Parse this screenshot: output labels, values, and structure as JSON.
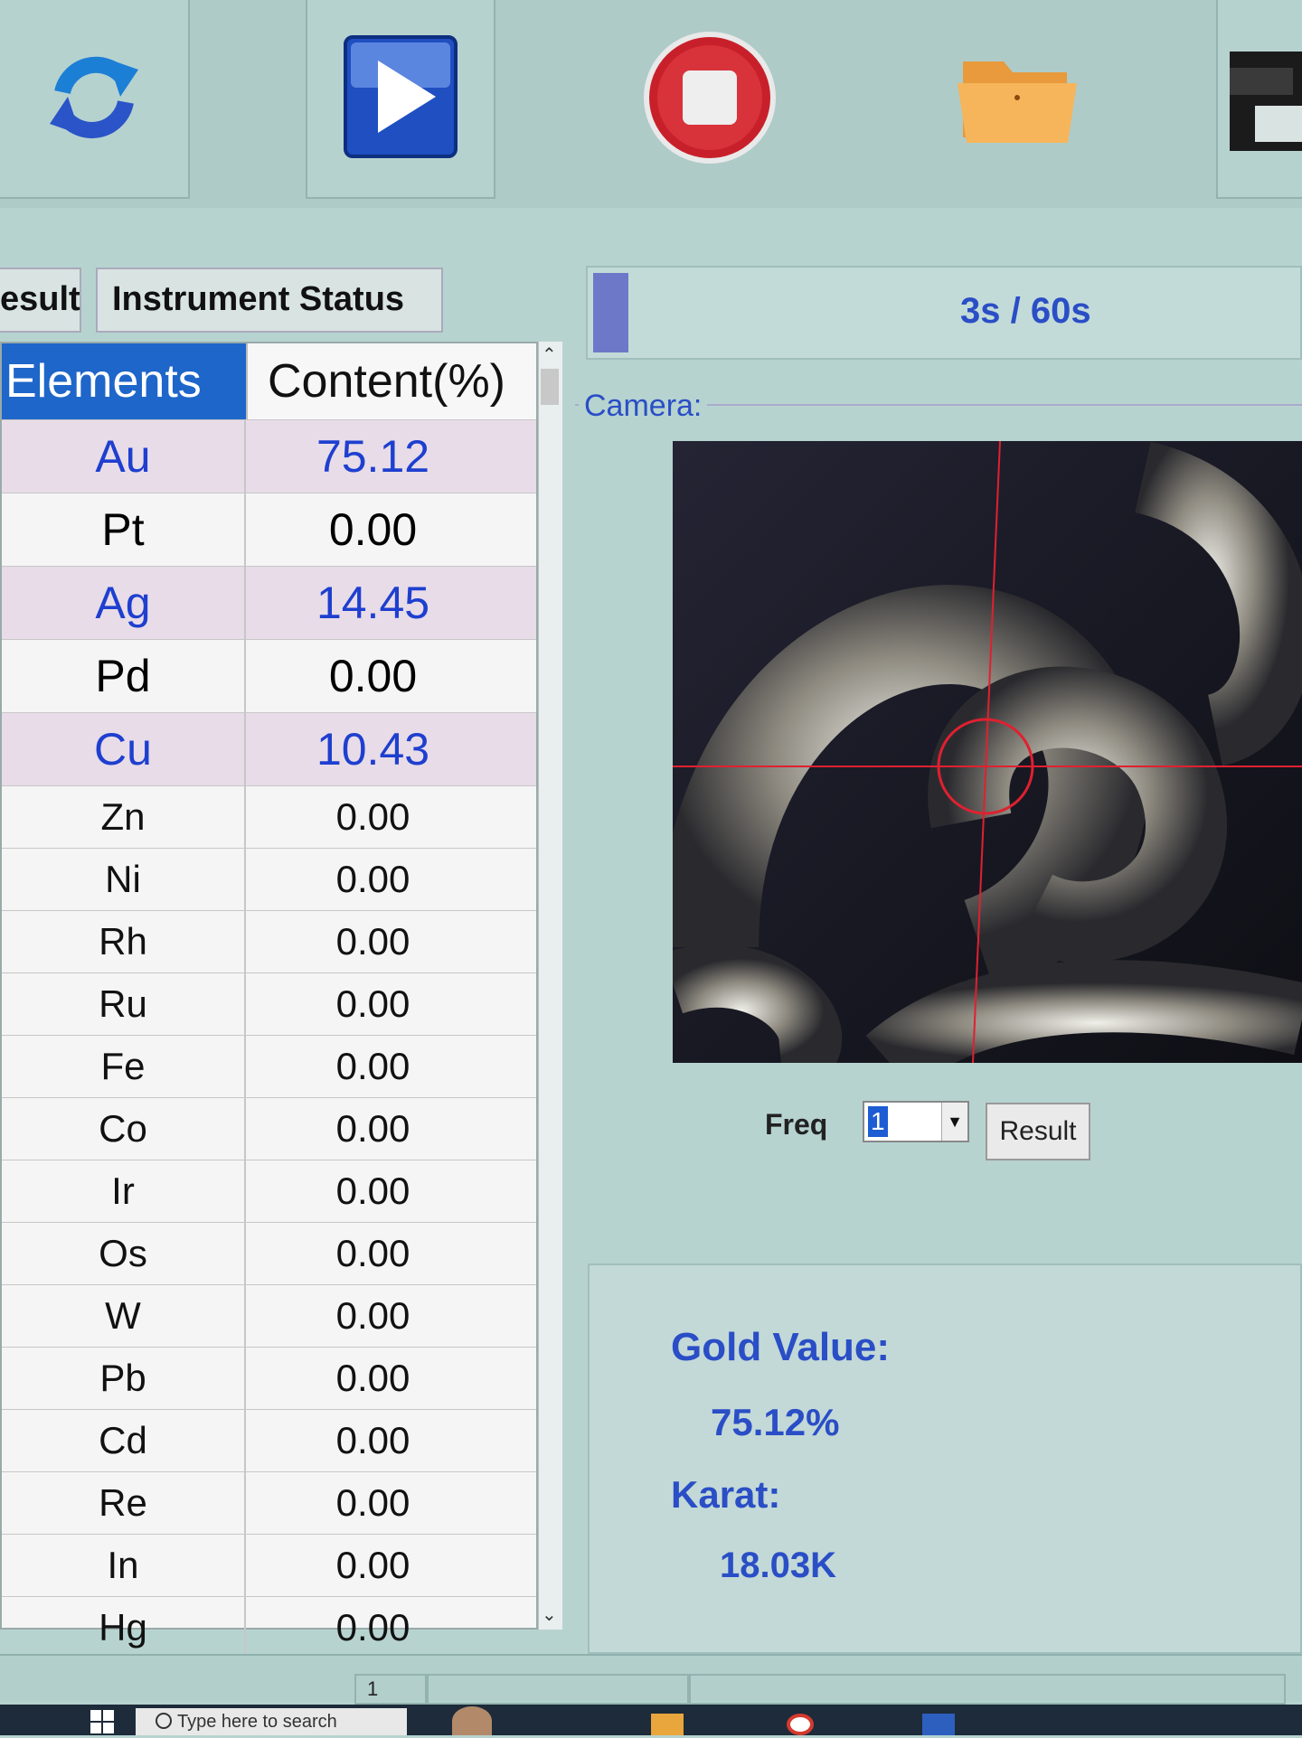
{
  "toolbar": {
    "buttons": [
      {
        "icon": "refresh-icon"
      },
      {
        "icon": "play-icon"
      },
      {
        "icon": "stop-icon"
      },
      {
        "icon": "folder-icon"
      },
      {
        "icon": "save-icon"
      }
    ]
  },
  "tabs": {
    "result_label": "esult",
    "instrument_status_label": "Instrument Status"
  },
  "grid": {
    "header_elements": "Elements",
    "header_content": "Content(%)",
    "rows": [
      {
        "element": "Au",
        "content": "75.12"
      },
      {
        "element": "Pt",
        "content": "0.00"
      },
      {
        "element": "Ag",
        "content": "14.45"
      },
      {
        "element": "Pd",
        "content": "0.00"
      },
      {
        "element": "Cu",
        "content": "10.43"
      },
      {
        "element": "Zn",
        "content": "0.00"
      },
      {
        "element": "Ni",
        "content": "0.00"
      },
      {
        "element": "Rh",
        "content": "0.00"
      },
      {
        "element": "Ru",
        "content": "0.00"
      },
      {
        "element": "Fe",
        "content": "0.00"
      },
      {
        "element": "Co",
        "content": "0.00"
      },
      {
        "element": "Ir",
        "content": "0.00"
      },
      {
        "element": "Os",
        "content": "0.00"
      },
      {
        "element": "W",
        "content": "0.00"
      },
      {
        "element": "Pb",
        "content": "0.00"
      },
      {
        "element": "Cd",
        "content": "0.00"
      },
      {
        "element": "Re",
        "content": "0.00"
      },
      {
        "element": "In",
        "content": "0.00"
      },
      {
        "element": "Hg",
        "content": "0.00"
      }
    ]
  },
  "progress": {
    "text": "3s / 60s",
    "fraction": 0.05
  },
  "camera": {
    "label": "Camera:"
  },
  "controls": {
    "freq_label": "Freq",
    "freq_value": "1",
    "result_button": "Result"
  },
  "gold": {
    "value_label": "Gold Value:",
    "value": "75.12%",
    "karat_label": "Karat:",
    "karat": "18.03K"
  },
  "status_bar": {
    "page": "1"
  },
  "taskbar": {
    "search_placeholder": "Type here to search"
  },
  "colors": {
    "accent_blue": "#2a4ec6",
    "header_blue": "#1e66c9",
    "highlight_row": "#e8dce8",
    "background": "#b7d3d0"
  }
}
